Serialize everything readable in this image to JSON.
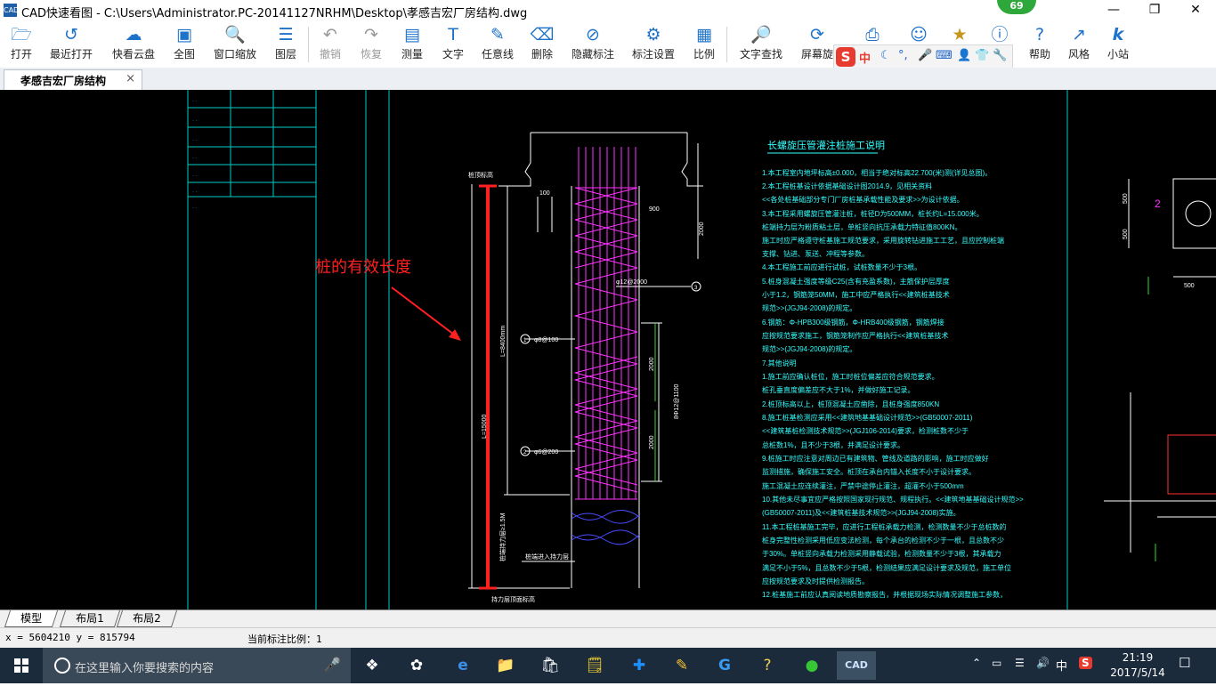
{
  "window": {
    "app_icon": "CAD",
    "title": "CAD快速看图 - C:\\Users\\Administrator.PC-20141127NRHM\\Desktop\\孝感吉宏厂房结构.dwg",
    "badge_count": "69"
  },
  "toolbar": {
    "items": [
      {
        "label": "打开",
        "icon": "folder-open-icon"
      },
      {
        "label": "最近打开",
        "icon": "history-icon"
      },
      {
        "label": "快看云盘",
        "icon": "cloud-icon"
      },
      {
        "label": "全图",
        "icon": "fit-screen-icon"
      },
      {
        "label": "窗口缩放",
        "icon": "zoom-window-icon"
      },
      {
        "label": "图层",
        "icon": "layers-icon"
      },
      {
        "label": "撤销",
        "icon": "undo-icon"
      },
      {
        "label": "恢复",
        "icon": "redo-icon"
      },
      {
        "label": "测量",
        "icon": "ruler-icon"
      },
      {
        "label": "文字",
        "icon": "text-icon"
      },
      {
        "label": "任意线",
        "icon": "pen-icon"
      },
      {
        "label": "删除",
        "icon": "eraser-icon"
      },
      {
        "label": "隐藏标注",
        "icon": "eye-hide-icon"
      },
      {
        "label": "标注设置",
        "icon": "gear-icon"
      },
      {
        "label": "比例",
        "icon": "scale-icon"
      },
      {
        "label": "文字查找",
        "icon": "text-search-icon"
      },
      {
        "label": "屏幕旋",
        "icon": "rotate-screen-icon"
      },
      {
        "label": "帮助",
        "icon": "help-icon"
      },
      {
        "label": "风格",
        "icon": "style-icon"
      },
      {
        "label": "小站",
        "icon": "k-station-icon"
      }
    ]
  },
  "ime_bar": {
    "logo": "S",
    "mode": "中",
    "items": [
      "☾",
      "°,",
      "🎤",
      "⌨",
      "👤",
      "👕",
      "🔧"
    ]
  },
  "tab": {
    "title": "孝感吉宏厂房结构",
    "close": "×"
  },
  "drawing": {
    "annotation": "桩的有效长度",
    "notes_title": "长螺旋压管灌注桩施工说明",
    "notes": [
      "1.本工程室内地坪标高±0.000，相当于绝对标高22.700(米)测(详见总图)。",
      "2.本工程桩基设计依据基础设计图2014.9，见相关资料",
      "  <<各处桩基础部分专门厂房桩基承载性能及要求>>为设计依据。",
      "3.本工程采用螺旋压管灌注桩，桩径D为500MM，桩长约L=15.000米。",
      "  桩端持力层为粉质粘土层，单桩竖向抗压承载力特征值800KN。",
      "  施工时应严格遵守桩基施工规范要求，采用旋转钻进施工工艺，且应控制桩端",
      "  支撑、钻进、泵送、冲程等参数。",
      "4.本工程施工前应进行试桩，试桩数量不少于3根。",
      "5.桩身混凝土强度等级C25(含有充盈系数)，主筋保护层厚度",
      "  小于1.2，钢筋笼50MM，施工中应严格执行<<建筑桩基技术",
      "  规范>>(JGJ94-2008)的规定。",
      "6.钢筋：Φ-HPB300级钢筋，Φ-HRB400级钢筋，钢筋焊接",
      "  应按规范要求施工，钢筋笼制作应严格执行<<建筑桩基技术",
      "  规范>>(JGJ94-2008)的规定。",
      "7.其他说明",
      "  1.施工前应确认桩位，施工时桩位偏差应符合规范要求。",
      "    桩孔垂直度偏差应不大于1%，并做好施工记录。",
      "  2.桩顶标高以上，桩顶混凝土应凿除，且桩身强度850KN",
      "8.施工桩基检测应采用<<建筑地基基础设计规范>>(GB50007-2011)",
      "  <<建筑基桩检测技术规范>>(JGJ106-2014)要求，检测桩数不少于",
      "  总桩数1%，且不少于3根，并满足设计要求。",
      "9.桩施工时应注意对周边已有建筑物、管线及道路的影响，施工时应做好",
      "  监测措施，确保施工安全。桩顶在承台内锚入长度不小于设计要求。",
      "  施工混凝土应连续灌注，严禁中途停止灌注，超灌不小于500mm",
      "10.其他未尽事宜应严格按照国家现行规范、规程执行。<<建筑地基基础设计规范>>",
      "  (GB50007-2011)及<<建筑桩基技术规范>>(JGJ94-2008)实施。",
      "11.本工程桩基施工完毕，应进行工程桩承载力检测，检测数量不少于总桩数的",
      "  桩身完整性检测采用低应变法检测，每个承台的检测不少于一根，且总数不少",
      "  于30%。单桩竖向承载力检测采用静载试验，检测数量不少于3根，其承载力",
      "  满足不小于5%，且总数不少于5根，检测结果应满足设计要求及规范，施工单位",
      "  应按规范要求及时提供检测报告。",
      "12.桩基施工前应认真阅读地质勘察报告，并根据现场实际情况调整施工参数，"
    ],
    "pile_labels": {
      "cap_top": "桩顶标高",
      "l_total": "L=15000",
      "l_cage": "L=8400mm",
      "rebar_top": "φ8@100",
      "rebar_mid": "φ12@2000",
      "stirrup": "φ6@200",
      "main_bar": "8Φ12@1100",
      "dim_2000": "2000",
      "dim_2000b": "2000",
      "dim_2000c": "2000",
      "dim_900": "900",
      "dim_100": "100",
      "bottom": "桩端进入持力层",
      "bottom_dim": "桩端持力层≥1.5M",
      "base_label": "持力层顶面标高",
      "circle_1": "1",
      "circle_2": "2",
      "circle_3": "3"
    },
    "right_detail": {
      "label": "2",
      "dim_500": "500",
      "dim_500b": "500",
      "dim_500c": "500"
    }
  },
  "layout_tabs": [
    "模型",
    "布局1",
    "布局2"
  ],
  "status": {
    "coords": "x = 5604210  y = 815794",
    "scale": "当前标注比例：1"
  },
  "taskbar": {
    "search_placeholder": "在这里输入你要搜索的内容",
    "tray_lang": "中",
    "time": "21:19",
    "date": "2017/5/14"
  }
}
